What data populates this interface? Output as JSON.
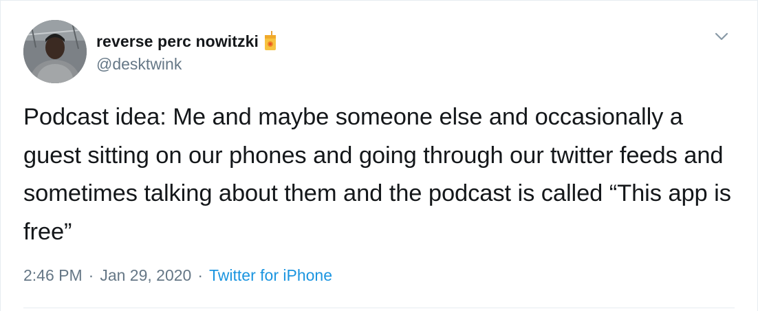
{
  "author": {
    "display_name": "reverse perc nowitzki",
    "badge_icon": "juice-box-icon",
    "handle": "@desktwink"
  },
  "tweet": {
    "text": "Podcast idea: Me and maybe someone else and occasionally a guest sitting on our phones and going through our twitter feeds and sometimes talking about them and the podcast is called “This app is free”"
  },
  "meta": {
    "time": "2:46 PM",
    "separator": "·",
    "date": "Jan 29, 2020",
    "source": "Twitter for iPhone"
  },
  "icons": {
    "menu": "chevron-down-icon"
  },
  "colors": {
    "text_primary": "#14171a",
    "text_secondary": "#657786",
    "link": "#1b95e0",
    "border": "#e6ecf0"
  }
}
